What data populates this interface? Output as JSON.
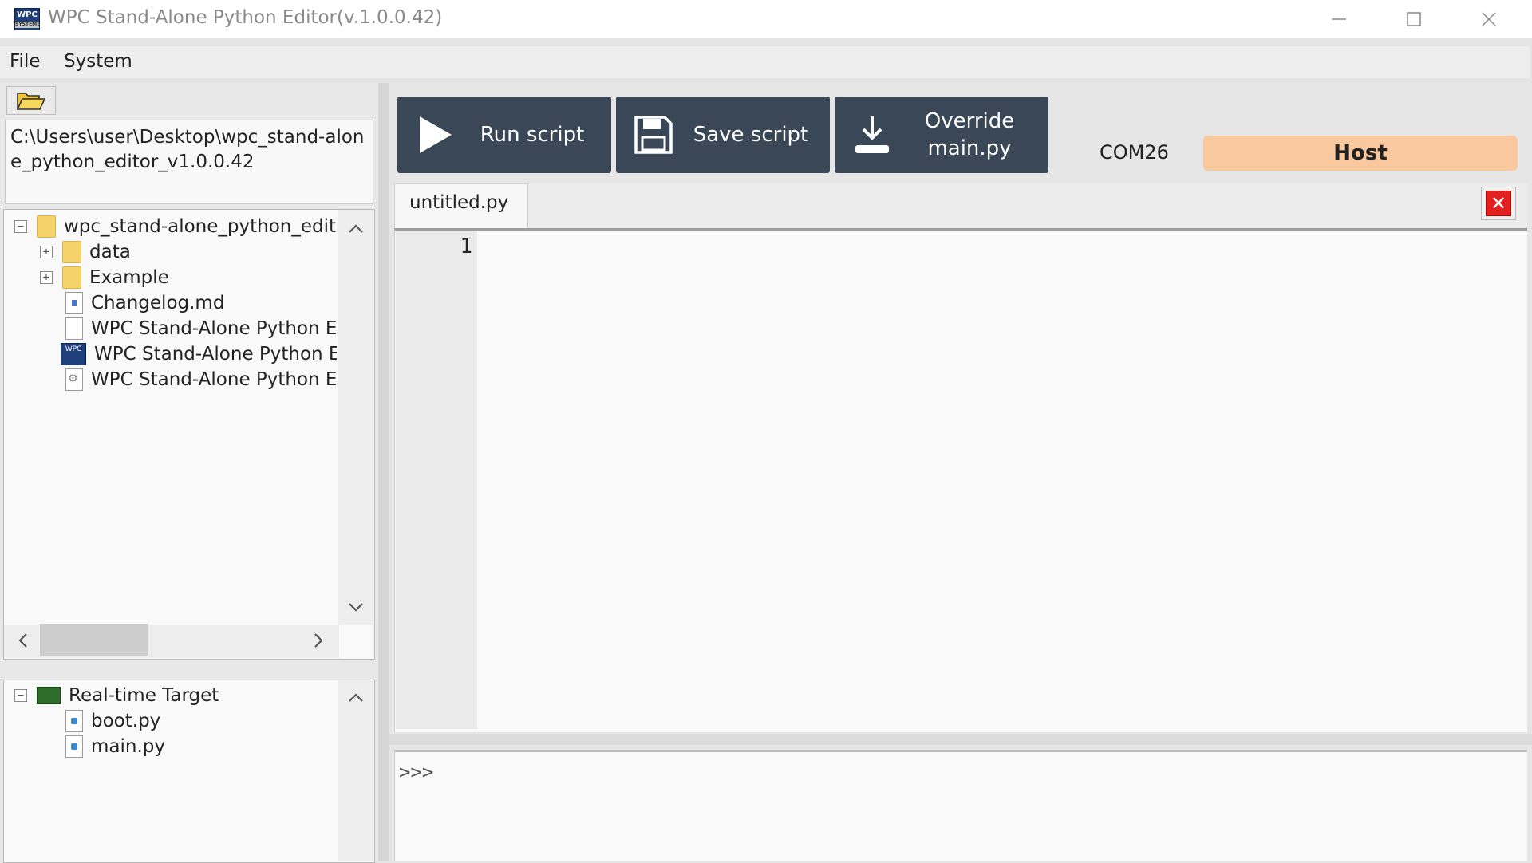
{
  "window": {
    "title": "WPC Stand-Alone Python Editor(v.1.0.0.42)",
    "icon_text": "WPC",
    "icon_subtext": "SYSTEMS"
  },
  "menu": {
    "items": [
      "File",
      "System"
    ]
  },
  "explorer": {
    "path": "C:\\Users\\user\\Desktop\\wpc_stand-alone_python_editor_v1.0.0.42",
    "tree": [
      {
        "label": "wpc_stand-alone_python_edit",
        "type": "folder",
        "expander": "−"
      },
      {
        "label": "data",
        "type": "folder",
        "expander": "+"
      },
      {
        "label": "Example",
        "type": "folder",
        "expander": "+"
      },
      {
        "label": "Changelog.md",
        "type": "md"
      },
      {
        "label": "WPC Stand-Alone Python E",
        "type": "blank"
      },
      {
        "label": "WPC Stand-Alone Python E",
        "type": "exe",
        "icon_text": "WPC"
      },
      {
        "label": "WPC Stand-Alone Python E",
        "type": "cfg"
      }
    ]
  },
  "target": {
    "root": "Real-time Target",
    "expander": "−",
    "files": [
      "boot.py",
      "main.py"
    ]
  },
  "toolbar": {
    "run_label": "Run script",
    "save_label": "Save script",
    "override_label_1": "Override",
    "override_label_2": "main.py"
  },
  "connection": {
    "port": "COM26",
    "mode": "Host",
    "mode_color": "#f9c89f"
  },
  "editor": {
    "tab_label": "untitled.py",
    "close_icon": "close-icon",
    "line_numbers": [
      "1"
    ]
  },
  "console": {
    "prompt": ">>>"
  },
  "icons": {
    "scroll_up": "chevron-up-icon",
    "scroll_down": "chevron-down-icon",
    "scroll_left": "chevron-left-icon",
    "scroll_right": "chevron-right-icon"
  }
}
